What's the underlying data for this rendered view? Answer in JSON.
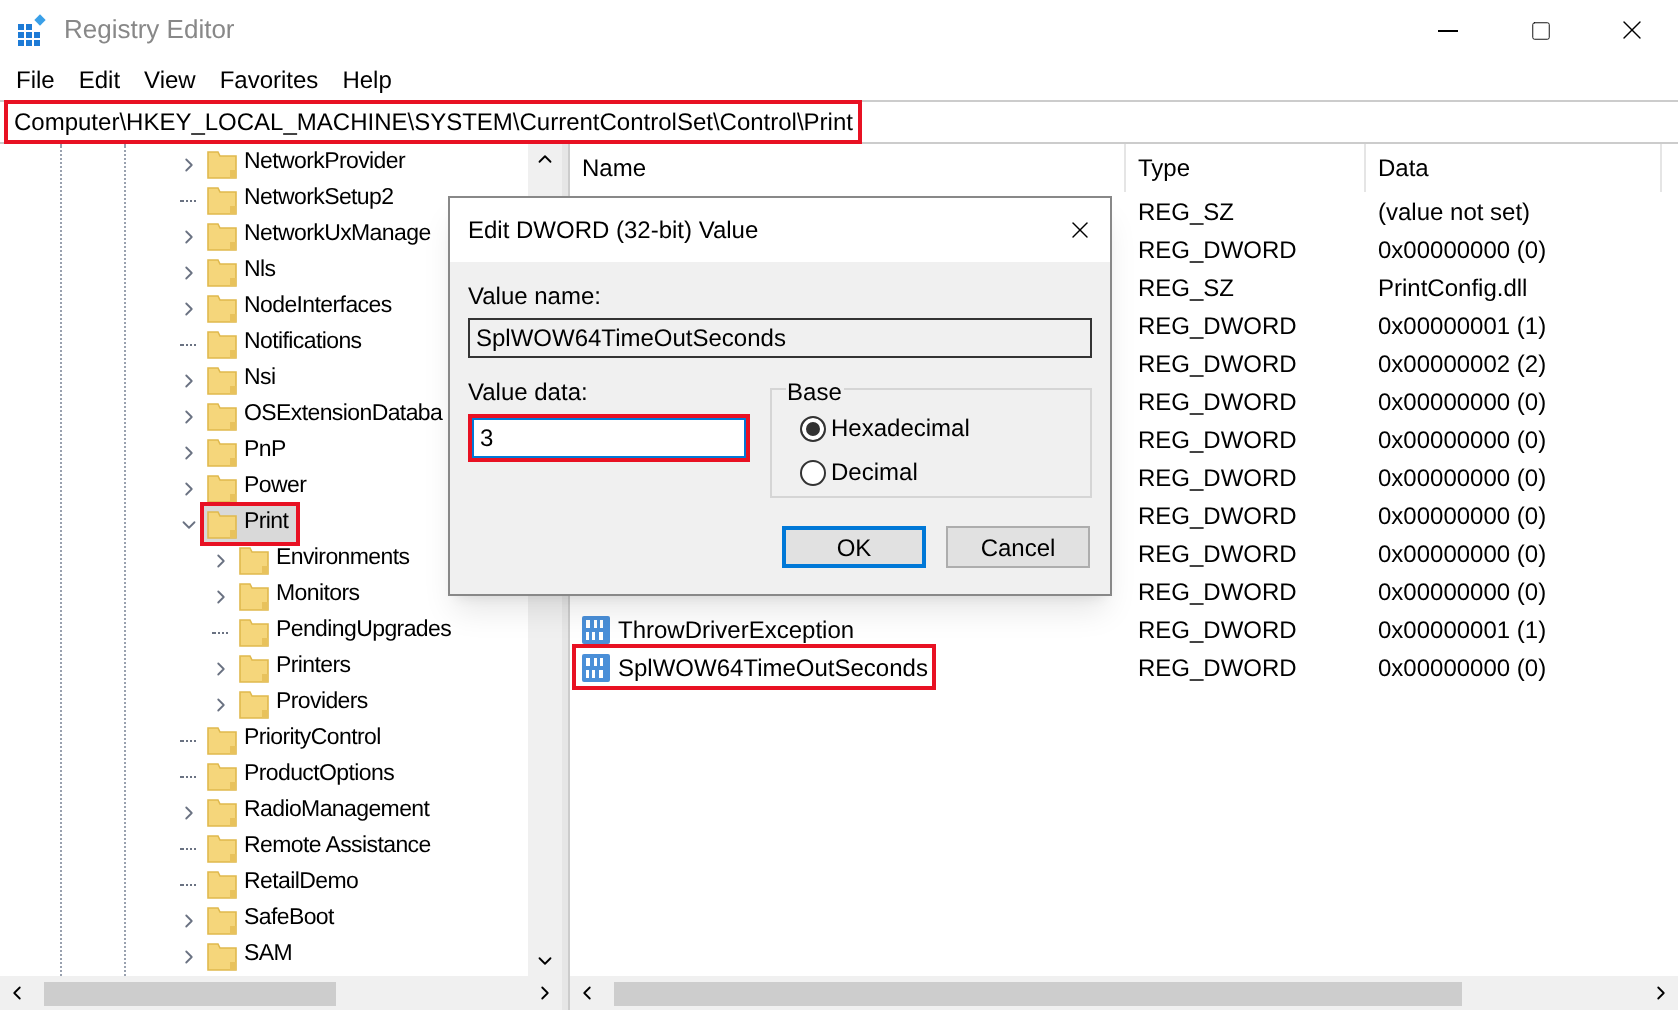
{
  "window": {
    "title": "Registry Editor"
  },
  "menu": [
    "File",
    "Edit",
    "View",
    "Favorites",
    "Help"
  ],
  "address_bar": {
    "path": "Computer\\HKEY_LOCAL_MACHINE\\SYSTEM\\CurrentControlSet\\Control\\Print",
    "highlighted": true
  },
  "tree": {
    "items": [
      {
        "label": "NetworkProvider",
        "kind": "branch",
        "expanded": false,
        "selected": false
      },
      {
        "label": "NetworkSetup2",
        "kind": "leaf",
        "selected": false
      },
      {
        "label": "NetworkUxManage",
        "kind": "branch",
        "expanded": false,
        "selected": false
      },
      {
        "label": "Nls",
        "kind": "branch",
        "expanded": false,
        "selected": false
      },
      {
        "label": "NodeInterfaces",
        "kind": "branch",
        "expanded": false,
        "selected": false
      },
      {
        "label": "Notifications",
        "kind": "leaf",
        "selected": false
      },
      {
        "label": "Nsi",
        "kind": "branch",
        "expanded": false,
        "selected": false
      },
      {
        "label": "OSExtensionDataba",
        "kind": "branch",
        "expanded": false,
        "selected": false
      },
      {
        "label": "PnP",
        "kind": "branch",
        "expanded": false,
        "selected": false
      },
      {
        "label": "Power",
        "kind": "branch",
        "expanded": false,
        "selected": false
      },
      {
        "label": "Print",
        "kind": "branch",
        "expanded": true,
        "selected": true,
        "highlighted": true,
        "children": [
          {
            "label": "Environments",
            "kind": "branch",
            "expanded": false,
            "selected": false
          },
          {
            "label": "Monitors",
            "kind": "branch",
            "expanded": false,
            "selected": false
          },
          {
            "label": "PendingUpgrades",
            "kind": "leaf",
            "selected": false
          },
          {
            "label": "Printers",
            "kind": "branch",
            "expanded": false,
            "selected": false
          },
          {
            "label": "Providers",
            "kind": "branch",
            "expanded": false,
            "selected": false
          }
        ]
      },
      {
        "label": "PriorityControl",
        "kind": "leaf",
        "selected": false
      },
      {
        "label": "ProductOptions",
        "kind": "leaf",
        "selected": false
      },
      {
        "label": "RadioManagement",
        "kind": "branch",
        "expanded": false,
        "selected": false
      },
      {
        "label": "Remote Assistance",
        "kind": "leaf",
        "selected": false
      },
      {
        "label": "RetailDemo",
        "kind": "leaf",
        "selected": false
      },
      {
        "label": "SafeBoot",
        "kind": "branch",
        "expanded": false,
        "selected": false
      },
      {
        "label": "SAM",
        "kind": "branch",
        "expanded": false,
        "selected": false
      }
    ]
  },
  "values": {
    "columns": [
      "Name",
      "Type",
      "Data"
    ],
    "rows": [
      {
        "type": "REG_SZ",
        "data": "(value not set)"
      },
      {
        "type": "REG_DWORD",
        "data": "0x00000000 (0)"
      },
      {
        "type": "REG_SZ",
        "data": "PrintConfig.dll"
      },
      {
        "type": "REG_DWORD",
        "data": "0x00000001 (1)"
      },
      {
        "type": "REG_DWORD",
        "data": "0x00000002 (2)"
      },
      {
        "type": "REG_DWORD",
        "data": "0x00000000 (0)"
      },
      {
        "type": "REG_DWORD",
        "data": "0x00000000 (0)"
      },
      {
        "type": "REG_DWORD",
        "data": "0x00000000 (0)"
      },
      {
        "type": "REG_DWORD",
        "data": "0x00000000 (0)"
      },
      {
        "type": "REG_DWORD",
        "data": "0x00000000 (0)"
      },
      {
        "type": "REG_DWORD",
        "data": "0x00000000 (0)"
      },
      {
        "name": "ThrowDriverException",
        "type": "REG_DWORD",
        "data": "0x00000001 (1)"
      },
      {
        "name": "SplWOW64TimeOutSeconds",
        "type": "REG_DWORD",
        "data": "0x00000000 (0)",
        "highlighted": true
      }
    ]
  },
  "dialog": {
    "title": "Edit DWORD (32-bit) Value",
    "value_name_label": "Value name:",
    "value_name": "SplWOW64TimeOutSeconds",
    "value_data_label": "Value data:",
    "value_data": "3",
    "value_data_highlighted": true,
    "base": {
      "label": "Base",
      "options": [
        {
          "label": "Hexadecimal",
          "selected": true
        },
        {
          "label": "Decimal",
          "selected": false
        }
      ]
    },
    "buttons": [
      {
        "label": "OK",
        "default": true
      },
      {
        "label": "Cancel",
        "default": false
      }
    ]
  }
}
